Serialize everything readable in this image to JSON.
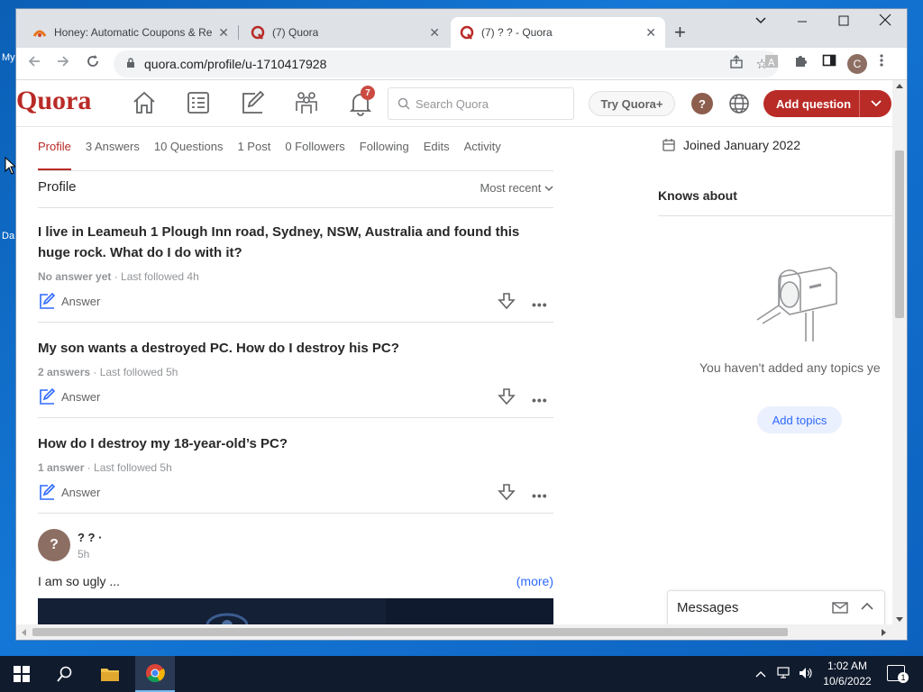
{
  "desktop": {
    "icon_labels": [
      "My",
      "Da"
    ]
  },
  "browser": {
    "tabs": [
      {
        "title": "Honey: Automatic Coupons & Re",
        "active": false
      },
      {
        "title": "(7) Quora",
        "active": false
      },
      {
        "title": "(7) ? ? - Quora",
        "active": true
      }
    ],
    "url": "quora.com/profile/u-1710417928",
    "profile_initial": "C"
  },
  "quora": {
    "logo": "Quora",
    "notification_count": "7",
    "search_placeholder": "Search Quora",
    "try_label": "Try Quora+",
    "help_label": "?",
    "add_question_label": "Add question",
    "profile_tabs": [
      "Profile",
      "3 Answers",
      "10 Questions",
      "1 Post",
      "0 Followers",
      "Following",
      "Edits",
      "Activity"
    ],
    "section_title": "Profile",
    "sort_label": "Most recent",
    "questions": [
      {
        "title": "I live in Leameuh 1 Plough Inn road, Sydney, NSW, Australia and found this huge rock. What do I do with it?",
        "answers": "No answer yet",
        "followed": " · Last followed 4h",
        "answer_label": "Answer"
      },
      {
        "title": "My son wants a destroyed PC. How do I destroy his PC?",
        "answers": "2 answers",
        "followed": " · Last followed 5h",
        "answer_label": "Answer"
      },
      {
        "title": "How do I destroy my 18-year-old’s PC?",
        "answers": "1 answer",
        "followed": " · Last followed 5h",
        "answer_label": "Answer"
      }
    ],
    "post": {
      "avatar": "?",
      "author": "? ? ·",
      "time": "5h",
      "text": "I am so ugly ...",
      "more": "(more)"
    },
    "sidebar": {
      "joined": "Joined January 2022",
      "knows_about": "Knows about",
      "no_topics": "You haven't added any topics ye",
      "add_topics": "Add topics",
      "messages": "Messages"
    }
  },
  "taskbar": {
    "time": "1:02 AM",
    "date": "10/6/2022",
    "notifications": "1"
  },
  "colors": {
    "brand": "#b92b27",
    "link": "#2e69ff",
    "taskbar": "#101b2d"
  }
}
